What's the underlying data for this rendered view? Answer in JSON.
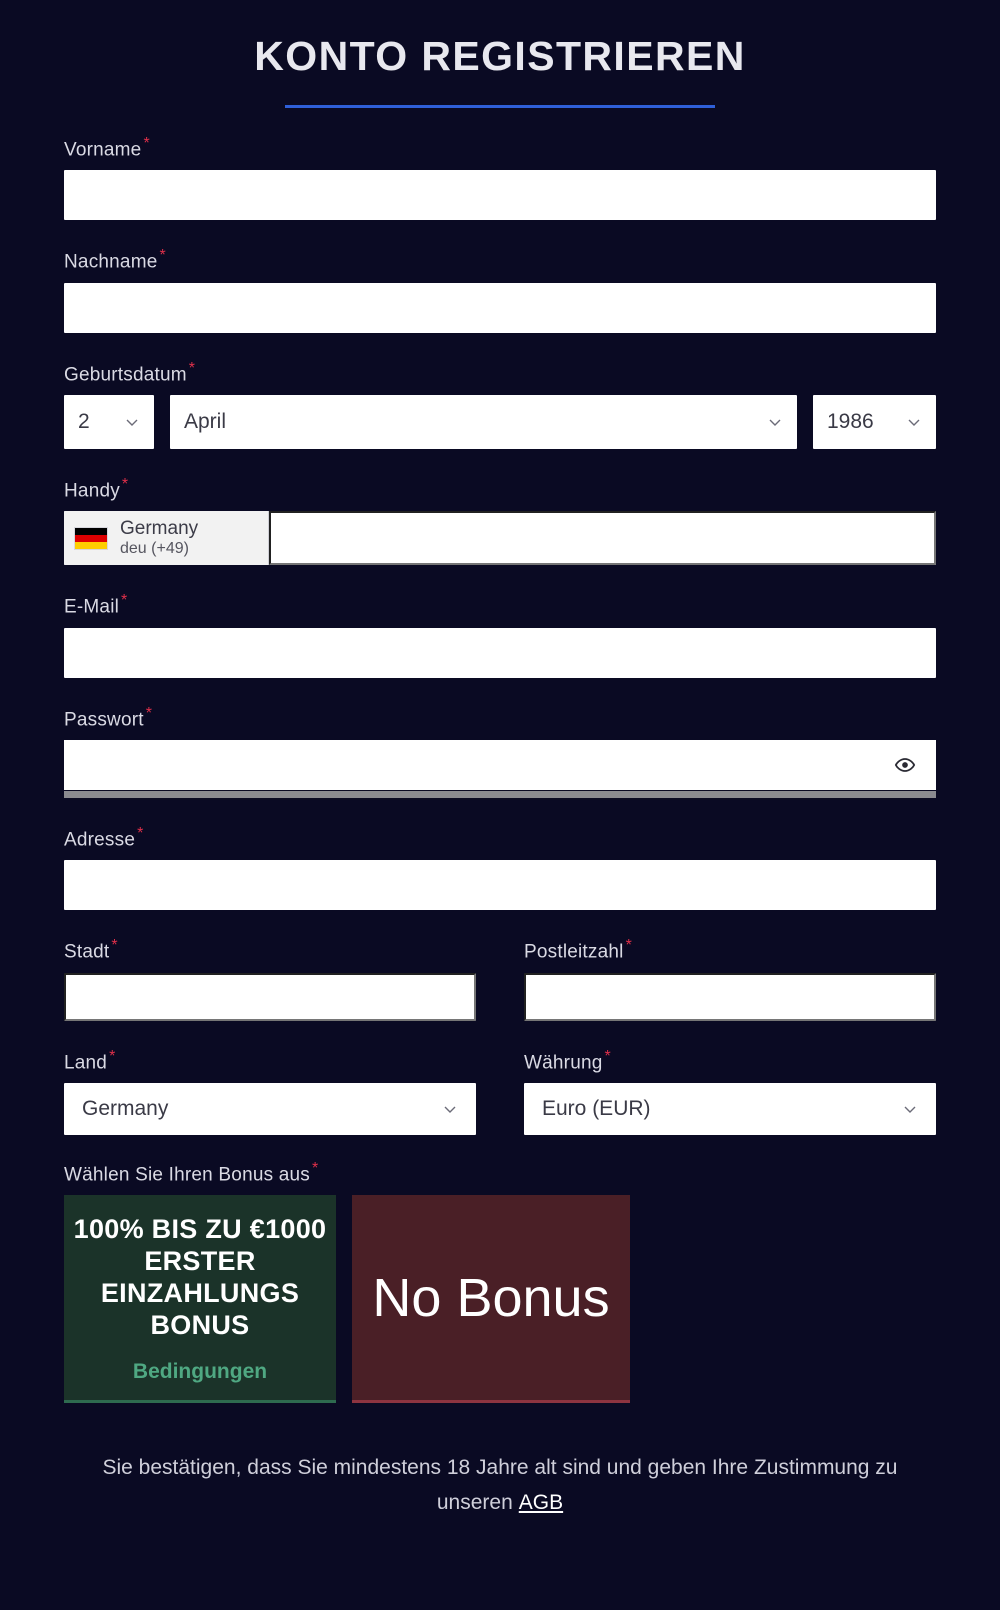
{
  "header": {
    "title": "KONTO REGISTRIEREN",
    "accent_color": "#2f5fd8"
  },
  "colors": {
    "background": "#0a0a23",
    "required_asterisk": "#e0304a",
    "label_text": "#dadae4",
    "input_background": "#ffffff"
  },
  "required_marker": "*",
  "fields": {
    "first_name": {
      "label": "Vorname",
      "value": "",
      "required": true
    },
    "last_name": {
      "label": "Nachname",
      "value": "",
      "required": true
    },
    "birthdate": {
      "label": "Geburtsdatum",
      "required": true,
      "day": "2",
      "month": "April",
      "year": "1986"
    },
    "phone": {
      "label": "Handy",
      "required": true,
      "country_name": "Germany",
      "country_code": "deu (+49)",
      "flag": "germany-flag",
      "value": ""
    },
    "email": {
      "label": "E-Mail",
      "value": "",
      "required": true
    },
    "password": {
      "label": "Passwort",
      "value": "",
      "required": true,
      "toggle_icon": "eye-icon",
      "strength_bar_color": "#8b8b90"
    },
    "address": {
      "label": "Adresse",
      "value": "",
      "required": true
    },
    "city": {
      "label": "Stadt",
      "value": "",
      "required": true
    },
    "postal_code": {
      "label": "Postleitzahl",
      "value": "",
      "required": true
    },
    "country": {
      "label": "Land",
      "value": "Germany",
      "required": true
    },
    "currency": {
      "label": "Währung",
      "value": "Euro (EUR)",
      "required": true
    }
  },
  "bonus": {
    "label": "Wählen Sie Ihren Bonus aus",
    "required": true,
    "options": [
      {
        "id": "deposit-bonus",
        "text": "100% BIS ZU €1000 ERSTER EINZAHLUNGS BONUS",
        "terms_link": "Bedingungen",
        "background": "#1b3329",
        "accent": "#2e6b4f"
      },
      {
        "id": "no-bonus",
        "text": "No Bonus",
        "background": "#4a1f26",
        "accent": "#8e3440"
      }
    ]
  },
  "footer": {
    "line1": "Sie bestätigen, dass Sie mindestens 18 Jahre alt sind und geben Ihre",
    "line2": "Zustimmung zu unseren",
    "terms_link": "AGB"
  }
}
